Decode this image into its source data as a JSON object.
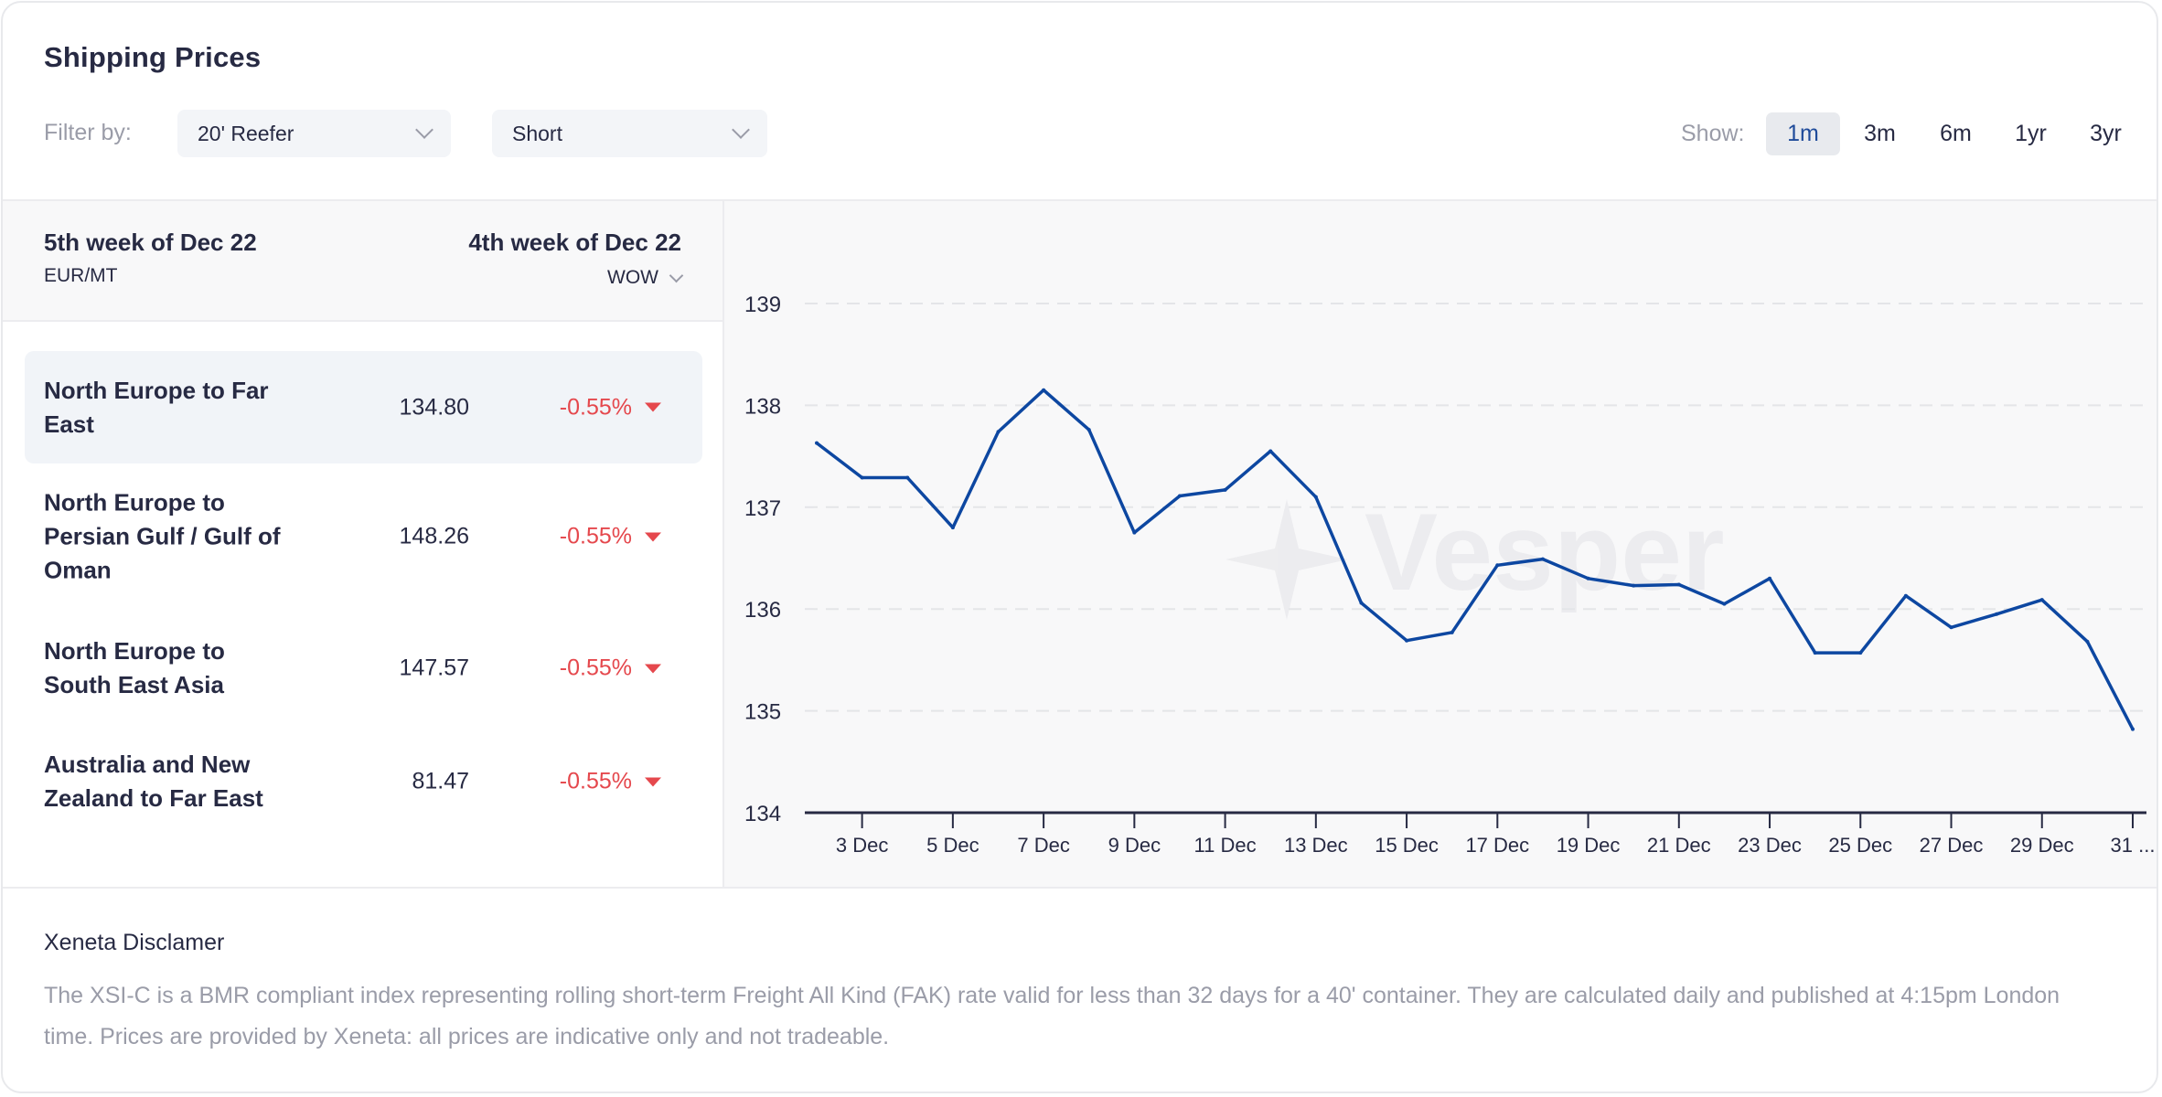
{
  "header": {
    "title": "Shipping Prices",
    "filter_label": "Filter by:",
    "filters": [
      {
        "value": "20' Reefer",
        "icon": "chevron-down-icon"
      },
      {
        "value": "Short",
        "icon": "chevron-down-icon"
      }
    ],
    "show_label": "Show:",
    "ranges": [
      {
        "label": "1m",
        "active": true
      },
      {
        "label": "3m",
        "active": false
      },
      {
        "label": "6m",
        "active": false
      },
      {
        "label": "1yr",
        "active": false
      },
      {
        "label": "3yr",
        "active": false
      }
    ]
  },
  "table": {
    "current_period": "5th week of Dec 22",
    "unit": "EUR/MT",
    "previous_period": "4th week of Dec 22",
    "comparison": "WOW",
    "rows": [
      {
        "route": "North Europe to Far East",
        "value": "134.80",
        "change": "-0.55%",
        "direction": "down",
        "active": true
      },
      {
        "route": "North Europe to Persian Gulf / Gulf of Oman",
        "value": "148.26",
        "change": "-0.55%",
        "direction": "down",
        "active": false
      },
      {
        "route": "North Europe to South East Asia",
        "value": "147.57",
        "change": "-0.55%",
        "direction": "down",
        "active": false
      },
      {
        "route": "Australia and New Zealand to Far East",
        "value": "81.47",
        "change": "-0.55%",
        "direction": "down",
        "active": false
      }
    ],
    "negative_color": "#e5484d"
  },
  "watermark": "Vesper",
  "disclaimer": {
    "title": "Xeneta Disclamer",
    "text": "The XSI-C is a BMR compliant index representing rolling short-term Freight All Kind (FAK) rate valid for less than 32 days for a 40' container. They are calculated daily and published at 4:15pm London time. Prices are provided by Xeneta: all prices are indicative only and not tradeable."
  },
  "chart_data": {
    "type": "line",
    "title": "",
    "xlabel": "",
    "ylabel": "",
    "ylim": [
      134,
      139
    ],
    "yticks": [
      134,
      135,
      136,
      137,
      138,
      139
    ],
    "grid": true,
    "line_color": "#0d47a1",
    "x": [
      "2 Dec",
      "3 Dec",
      "4 Dec",
      "5 Dec",
      "6 Dec",
      "7 Dec",
      "8 Dec",
      "9 Dec",
      "10 Dec",
      "11 Dec",
      "12 Dec",
      "13 Dec",
      "14 Dec",
      "15 Dec",
      "16 Dec",
      "17 Dec",
      "18 Dec",
      "19 Dec",
      "20 Dec",
      "21 Dec",
      "22 Dec",
      "23 Dec",
      "24 Dec",
      "25 Dec",
      "26 Dec",
      "27 Dec",
      "28 Dec",
      "29 Dec",
      "30 Dec",
      "31 Dec"
    ],
    "xtick_labels": [
      "3 Dec",
      "5 Dec",
      "7 Dec",
      "9 Dec",
      "11 Dec",
      "13 Dec",
      "15 Dec",
      "17 Dec",
      "19 Dec",
      "21 Dec",
      "23 Dec",
      "25 Dec",
      "27 Dec",
      "29 Dec",
      "31 ..."
    ],
    "series": [
      {
        "name": "North Europe to Far East",
        "values": [
          137.63,
          137.29,
          137.29,
          136.8,
          137.74,
          138.15,
          137.76,
          136.75,
          137.11,
          137.17,
          137.55,
          137.1,
          136.06,
          135.69,
          135.77,
          136.43,
          136.49,
          136.3,
          136.23,
          136.24,
          136.05,
          136.3,
          135.57,
          135.57,
          136.13,
          135.82,
          135.95,
          136.09,
          135.68,
          134.82
        ]
      }
    ]
  }
}
